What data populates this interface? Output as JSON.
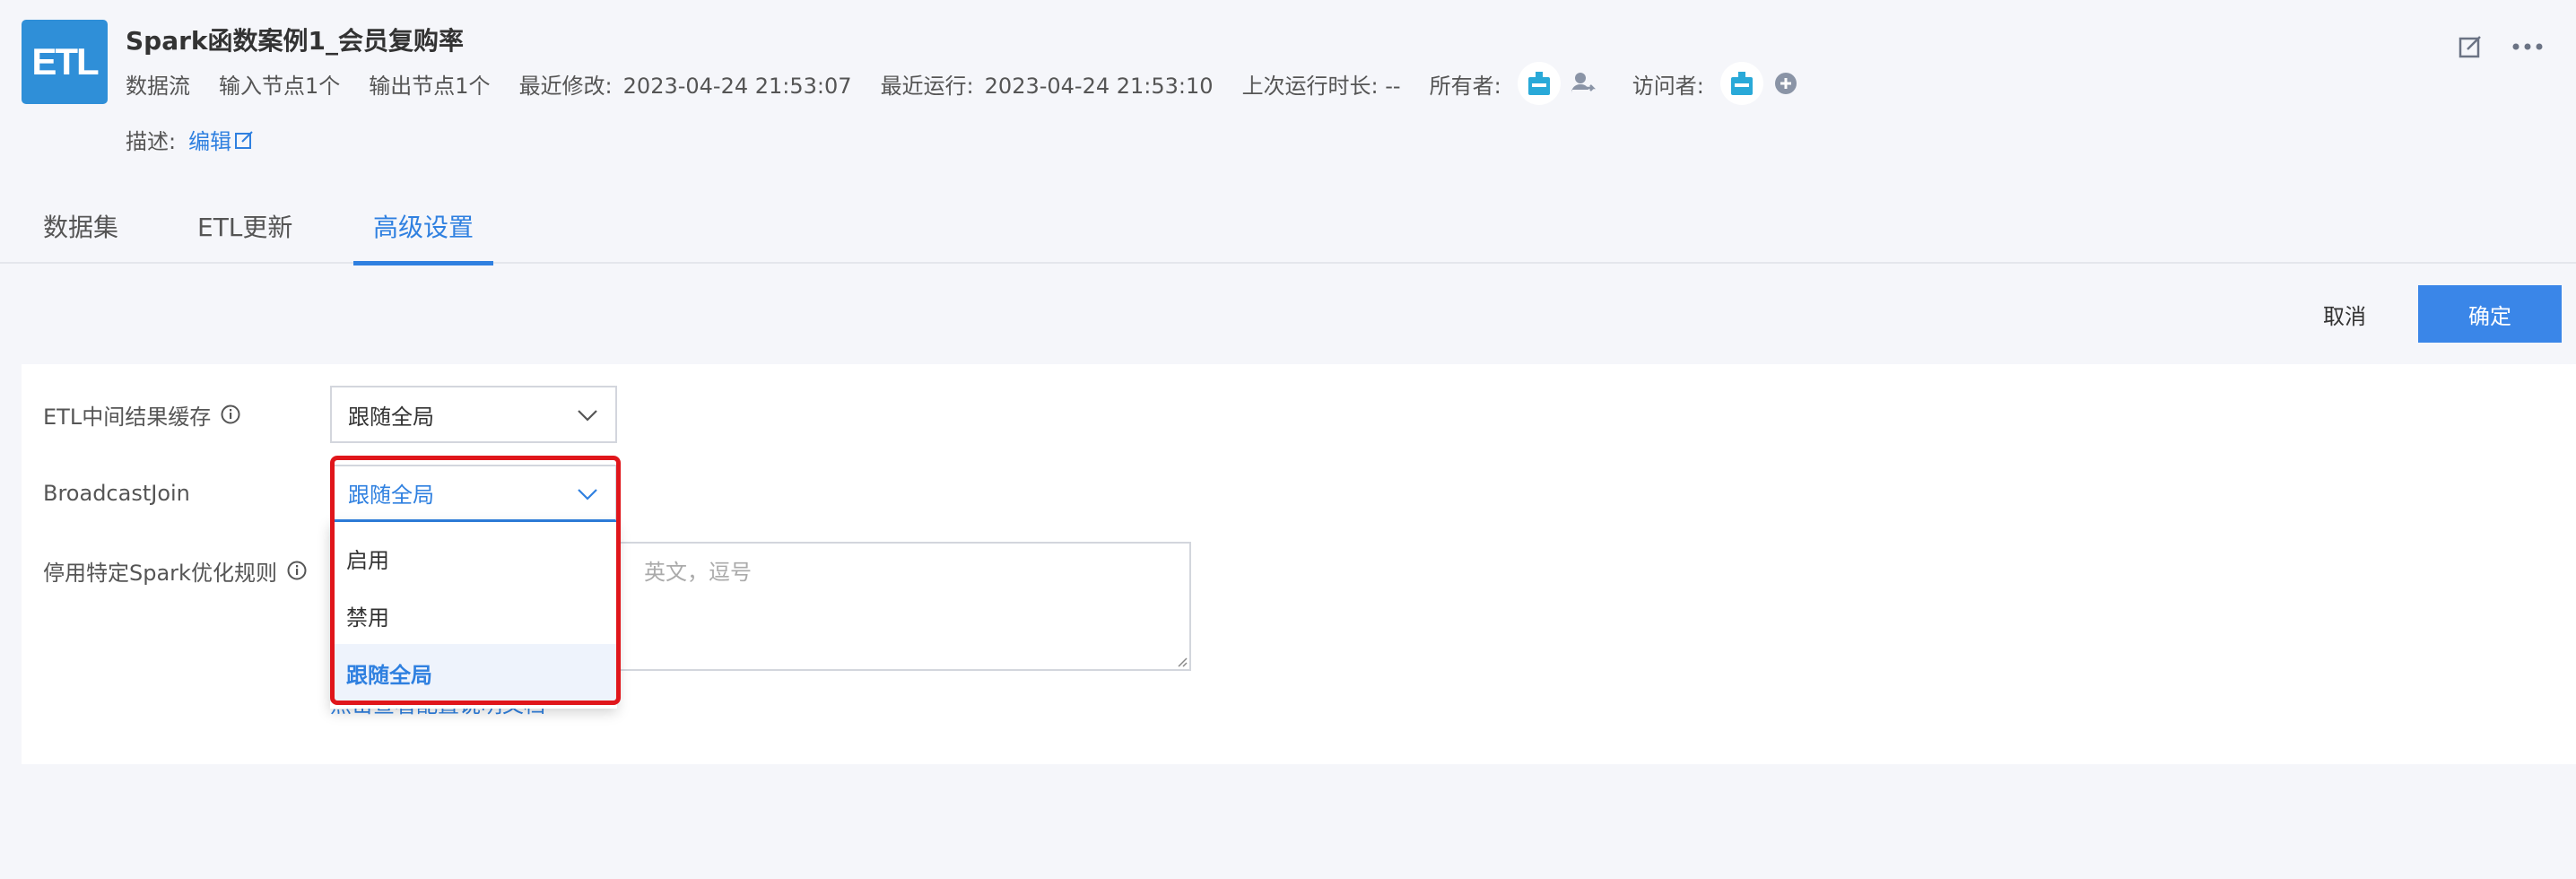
{
  "header": {
    "logo_text": "ETL",
    "title": "Spark函数案例1_会员复购率",
    "meta": {
      "type": "数据流",
      "input_nodes": "输入节点1个",
      "output_nodes": "输出节点1个",
      "modified_label": "最近修改:",
      "modified_value": "2023-04-24 21:53:07",
      "run_label": "最近运行:",
      "run_value": "2023-04-24 21:53:10",
      "duration": "上次运行时长: --",
      "owner_label": "所有者:",
      "visitor_label": "访问者:"
    },
    "desc_label": "描述:",
    "desc_edit": "编辑"
  },
  "tabs": [
    {
      "label": "数据集"
    },
    {
      "label": "ETL更新"
    },
    {
      "label": "高级设置"
    }
  ],
  "actions": {
    "cancel": "取消",
    "confirm": "确定"
  },
  "form": {
    "etl_cache": {
      "label": "ETL中间结果缓存",
      "value": "跟随全局"
    },
    "broadcast": {
      "label": "BroadcastJoin",
      "value": "跟随全局"
    },
    "spark_rules": {
      "label": "停用特定Spark优化规则",
      "placeholder": "英文，逗号"
    },
    "doc_link": "点击查看配置说明文档"
  },
  "dropdown": {
    "options": [
      "启用",
      "禁用",
      "跟随全局"
    ],
    "selected": "跟随全局"
  },
  "colors": {
    "accent": "#2f80e0",
    "highlight": "#e0161b",
    "logo": "#2f8fd8"
  }
}
